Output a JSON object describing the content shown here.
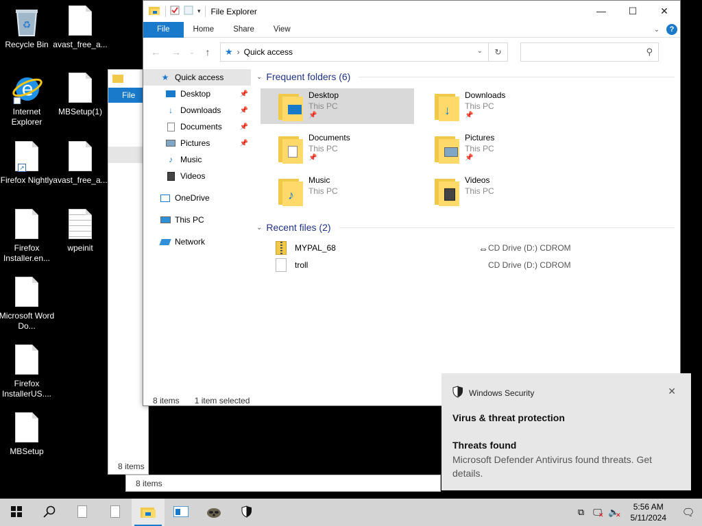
{
  "desktop": {
    "icons": [
      {
        "label": "Recycle Bin"
      },
      {
        "label": "avast_free_a..."
      },
      {
        "label": "Internet Explorer"
      },
      {
        "label": "MBSetup(1)"
      },
      {
        "label": "Firefox Nightly"
      },
      {
        "label": "avast_free_a..."
      },
      {
        "label": "Firefox Installer.en..."
      },
      {
        "label": "wpeinit"
      },
      {
        "label": "Microsoft Word Do..."
      },
      {
        "label": "Firefox InstallerUS...."
      },
      {
        "label": "MBSetup"
      }
    ]
  },
  "bg_window": {
    "file_tab": "File",
    "status": "8 items",
    "status2": "8 items"
  },
  "explorer": {
    "title": "File Explorer",
    "tabs": {
      "file": "File",
      "home": "Home",
      "share": "Share",
      "view": "View"
    },
    "help": "?",
    "address": {
      "location": "Quick access",
      "separator": "›"
    },
    "nav": {
      "quick_access": "Quick access",
      "desktop": "Desktop",
      "downloads": "Downloads",
      "documents": "Documents",
      "pictures": "Pictures",
      "music": "Music",
      "videos": "Videos",
      "onedrive": "OneDrive",
      "this_pc": "This PC",
      "network": "Network"
    },
    "frequent": {
      "header": "Frequent folders (6)",
      "items": [
        {
          "name": "Desktop",
          "sub": "This PC"
        },
        {
          "name": "Downloads",
          "sub": "This PC"
        },
        {
          "name": "Documents",
          "sub": "This PC"
        },
        {
          "name": "Pictures",
          "sub": "This PC"
        },
        {
          "name": "Music",
          "sub": "This PC"
        },
        {
          "name": "Videos",
          "sub": "This PC"
        }
      ]
    },
    "recent": {
      "header": "Recent files (2)",
      "items": [
        {
          "name": "MYPAL_68",
          "location": "CD Drive (D:) CDROM"
        },
        {
          "name": "troll",
          "location": "CD Drive (D:) CDROM"
        }
      ]
    },
    "status": {
      "count": "8 items",
      "selected": "1 item selected"
    }
  },
  "toast": {
    "app": "Windows Security",
    "title": "Virus & threat protection",
    "heading": "Threats found",
    "body": "Microsoft Defender Antivirus found threats. Get details."
  },
  "taskbar": {
    "time": "5:56 AM",
    "date": "5/11/2024"
  },
  "colors": {
    "accent": "#1979ca",
    "folder": "#ffd96a",
    "toast_bg": "#e7e7e7",
    "taskbar": "#d4d4d4"
  }
}
